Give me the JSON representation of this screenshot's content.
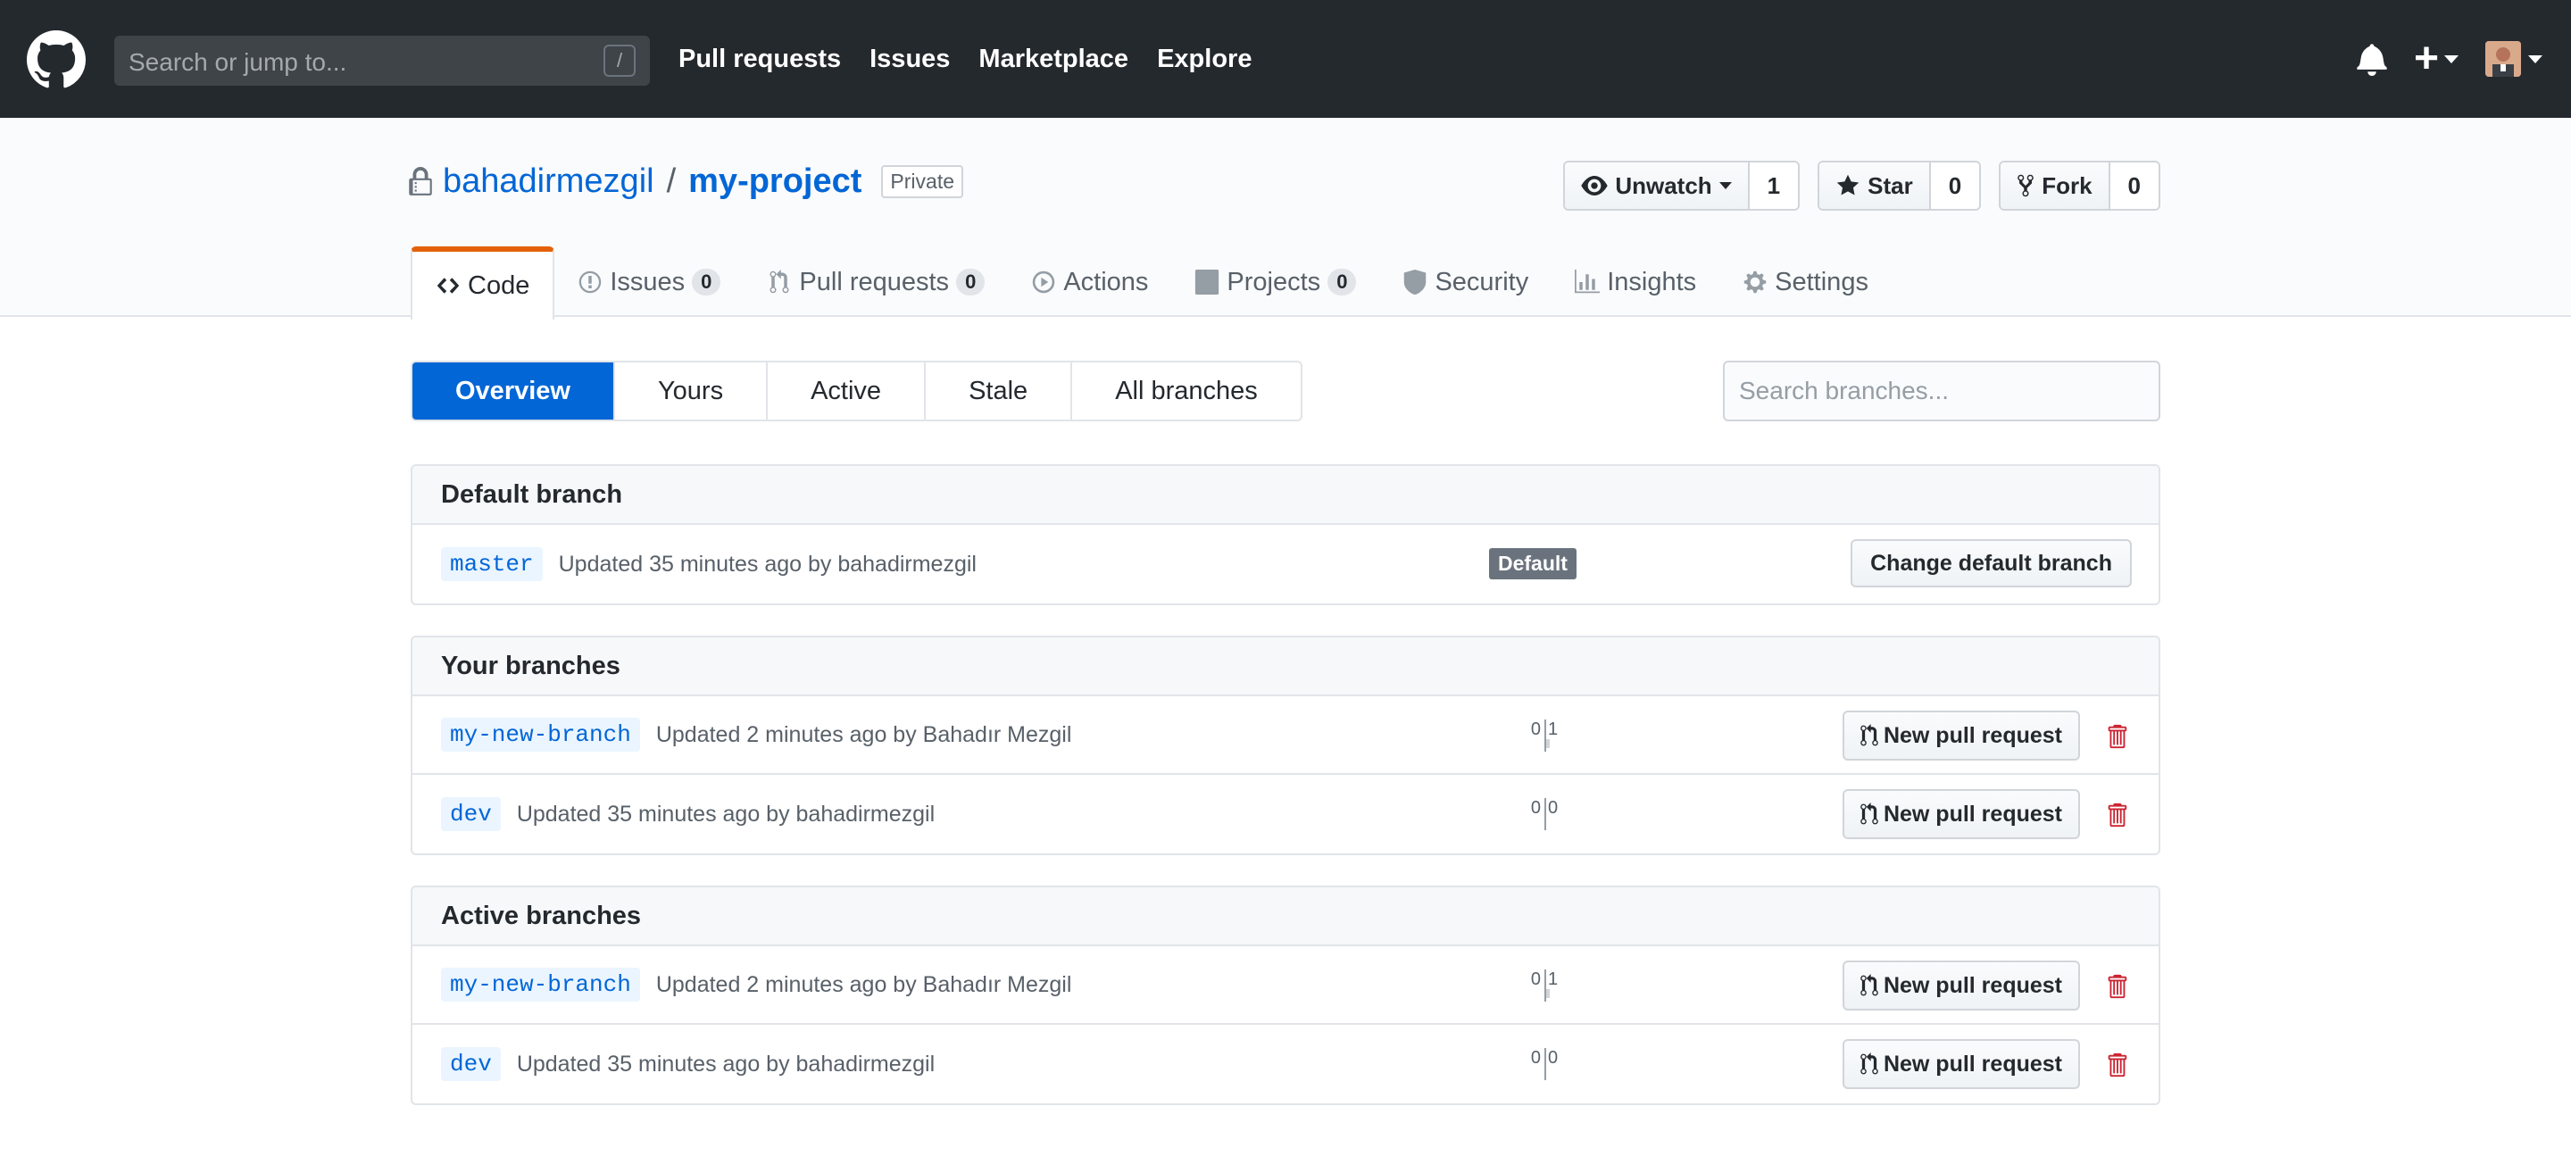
{
  "header": {
    "search_placeholder": "Search or jump to...",
    "search_shortcut": "/",
    "nav": [
      "Pull requests",
      "Issues",
      "Marketplace",
      "Explore"
    ],
    "plus_label": "+"
  },
  "repo": {
    "owner": "bahadirmezgil",
    "separator": "/",
    "name": "my-project",
    "visibility": "Private",
    "watch": {
      "label": "Unwatch",
      "count": "1"
    },
    "star": {
      "label": "Star",
      "count": "0"
    },
    "fork": {
      "label": "Fork",
      "count": "0"
    }
  },
  "tabs": [
    {
      "label": "Code",
      "icon": "code-icon",
      "counter": null,
      "active": true
    },
    {
      "label": "Issues",
      "icon": "issue-icon",
      "counter": "0"
    },
    {
      "label": "Pull requests",
      "icon": "pull-request-icon",
      "counter": "0"
    },
    {
      "label": "Actions",
      "icon": "play-icon"
    },
    {
      "label": "Projects",
      "icon": "project-icon",
      "counter": "0"
    },
    {
      "label": "Security",
      "icon": "shield-icon"
    },
    {
      "label": "Insights",
      "icon": "graph-icon"
    },
    {
      "label": "Settings",
      "icon": "gear-icon"
    }
  ],
  "subnav": {
    "items": [
      "Overview",
      "Yours",
      "Active",
      "Stale",
      "All branches"
    ],
    "selected": "Overview",
    "search_placeholder": "Search branches..."
  },
  "default_branch": {
    "title": "Default branch",
    "branch": "master",
    "updated": "Updated 35 minutes ago by bahadirmezgil",
    "badge": "Default",
    "change_label": "Change default branch"
  },
  "your_branches": {
    "title": "Your branches",
    "rows": [
      {
        "branch": "my-new-branch",
        "updated": "Updated 2 minutes ago by Bahadır Mezgil",
        "behind": "0",
        "ahead": "1",
        "pr_label": "New pull request"
      },
      {
        "branch": "dev",
        "updated": "Updated 35 minutes ago by bahadirmezgil",
        "behind": "0",
        "ahead": "0",
        "pr_label": "New pull request"
      }
    ]
  },
  "active_branches": {
    "title": "Active branches",
    "rows": [
      {
        "branch": "my-new-branch",
        "updated": "Updated 2 minutes ago by Bahadır Mezgil",
        "behind": "0",
        "ahead": "1",
        "pr_label": "New pull request"
      },
      {
        "branch": "dev",
        "updated": "Updated 35 minutes ago by bahadirmezgil",
        "behind": "0",
        "ahead": "0",
        "pr_label": "New pull request"
      }
    ]
  },
  "colors": {
    "header_bg": "#24292e",
    "link": "#0366d6",
    "active_tab_accent": "#e36209",
    "delete_red": "#cb2431"
  }
}
